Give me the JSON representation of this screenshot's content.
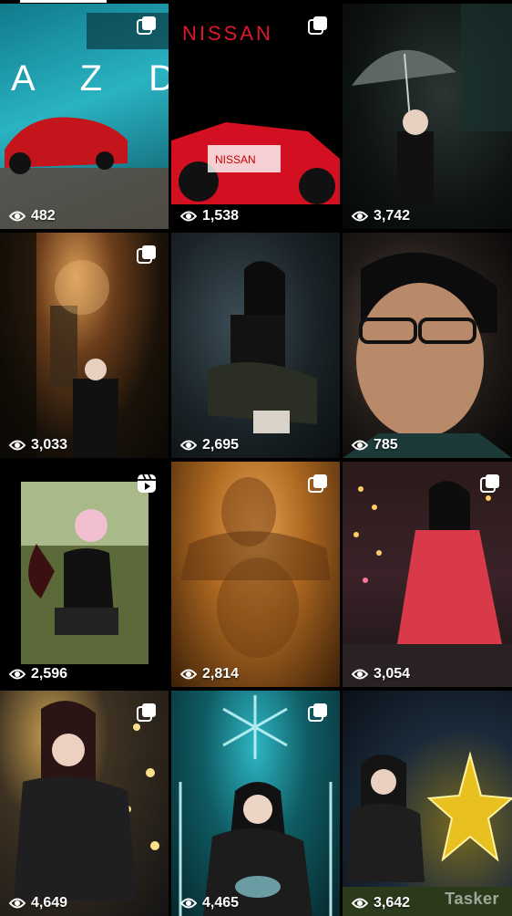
{
  "tiles": [
    {
      "views": "482",
      "badge": "multi-post"
    },
    {
      "views": "1,538",
      "badge": "multi-post"
    },
    {
      "views": "3,742",
      "badge": "none"
    },
    {
      "views": "3,033",
      "badge": "multi-post"
    },
    {
      "views": "2,695",
      "badge": "none"
    },
    {
      "views": "785",
      "badge": "none"
    },
    {
      "views": "2,596",
      "badge": "reel"
    },
    {
      "views": "2,814",
      "badge": "multi-post"
    },
    {
      "views": "3,054",
      "badge": "multi-post"
    },
    {
      "views": "4,649",
      "badge": "multi-post"
    },
    {
      "views": "4,465",
      "badge": "multi-post"
    },
    {
      "views": "3,642",
      "badge": "none"
    }
  ],
  "tile1_text": {
    "brand": "A Z D"
  },
  "tile2_text": {
    "brand": "NISSAN",
    "car_label": "NISSAN"
  },
  "watermark": {
    "text": "Tasker"
  }
}
